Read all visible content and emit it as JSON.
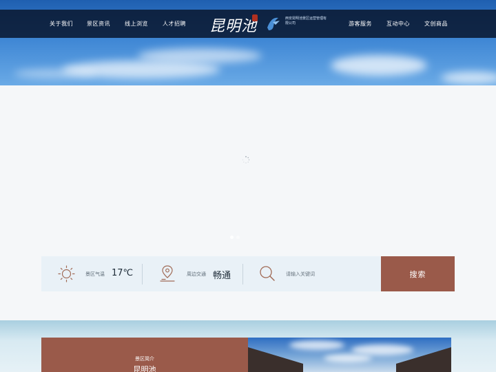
{
  "nav": {
    "left_items": [
      "关于我们",
      "景区资讯",
      "线上浏览",
      "人才招聘"
    ],
    "right_items": [
      "游客服务",
      "互动中心",
      "文创商品"
    ],
    "logo_text": "昆明池",
    "company_text": "西安昆明池景区运营管理有限公司"
  },
  "info": {
    "weather_label": "景区气温",
    "weather_value": "17℃",
    "traffic_label": "周边交通",
    "traffic_value": "畅通",
    "search_placeholder": "请输入关键词",
    "search_button": "搜索"
  },
  "intro": {
    "subtitle": "景区简介",
    "title": "昆明池"
  },
  "colors": {
    "nav_bg": "#0a1932",
    "accent": "#9a5a4a",
    "infobar_bg": "#e9f1f7"
  },
  "icons": [
    "sun-icon",
    "location-pin-icon",
    "search-icon",
    "loading-spinner-icon"
  ]
}
